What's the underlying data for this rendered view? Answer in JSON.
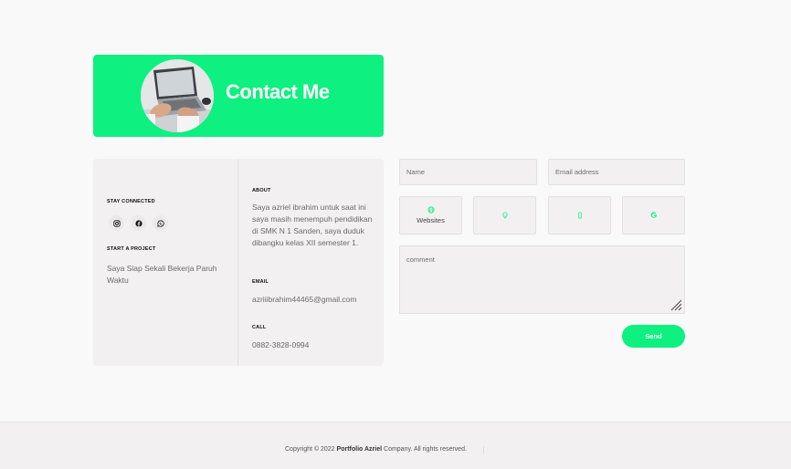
{
  "banner": {
    "title": "Contact Me"
  },
  "info": {
    "stay_connected_label": "STAY CONNECTED",
    "social_icons": [
      "instagram-icon",
      "facebook-icon",
      "whatsapp-icon"
    ],
    "start_project_label": "START A PROJECT",
    "start_project_text": "Saya Siap Sekali Bekerja Paruh Waktu",
    "about_label": "ABOUT",
    "about_text": "Saya azriel ibrahim untuk saat ini saya masih menempuh pendidikan di SMK N 1 Sanden, saya duduk dibangku kelas XII semester 1.",
    "email_label": "EMAIL",
    "email_value": "azriiibrahim44465@gmail.com",
    "call_label": "CALL",
    "call_value": "0882-3828-0994"
  },
  "form": {
    "name_placeholder": "Name",
    "email_placeholder": "Email address",
    "options": [
      {
        "icon": "globe-icon",
        "label": "Websites"
      },
      {
        "icon": "lightbulb-icon",
        "label": ""
      },
      {
        "icon": "mobile-icon",
        "label": ""
      },
      {
        "icon": "google-icon",
        "label": ""
      }
    ],
    "comment_placeholder": "comment",
    "send_label": "Send"
  },
  "footer": {
    "prefix": "Copyright © 2022 ",
    "brand": "Portfolio Azriel",
    "suffix": " Company. All rights reserved."
  },
  "colors": {
    "accent": "#0ef07f",
    "card": "#f2f0f0",
    "background": "#f9f9f9"
  }
}
